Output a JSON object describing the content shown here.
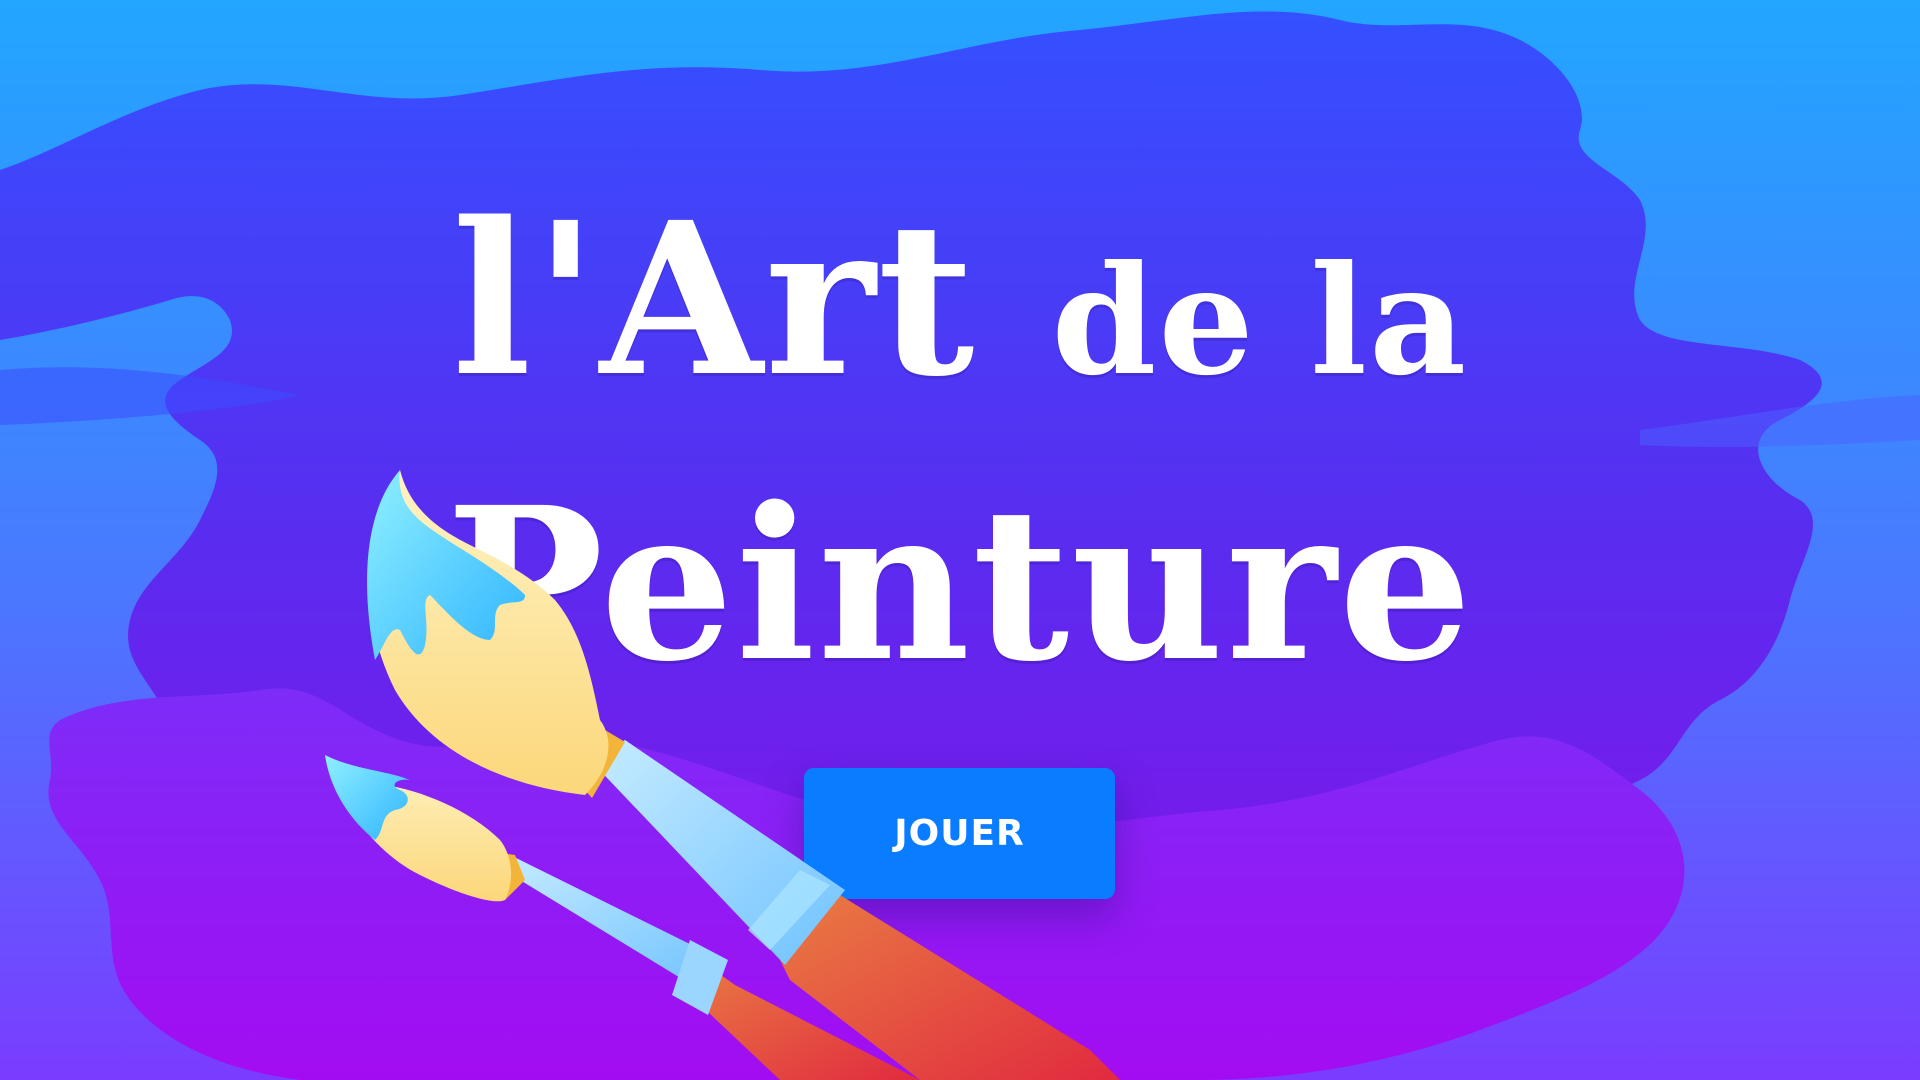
{
  "title": {
    "line1_part1": "l'Art",
    "line1_part2": "de la",
    "line2": "Peinture"
  },
  "play_button": {
    "label": "JOUER"
  },
  "colors": {
    "sky_top": "#22a6ff",
    "sky_bottom": "#6a4dff",
    "splash_top": "#3a4dff",
    "splash_bottom": "#9a12ea",
    "button": "#0a7cff",
    "text": "#ffffff"
  },
  "icons": [
    "paint-splash",
    "large-paintbrush-icon",
    "small-paintbrush-icon"
  ]
}
